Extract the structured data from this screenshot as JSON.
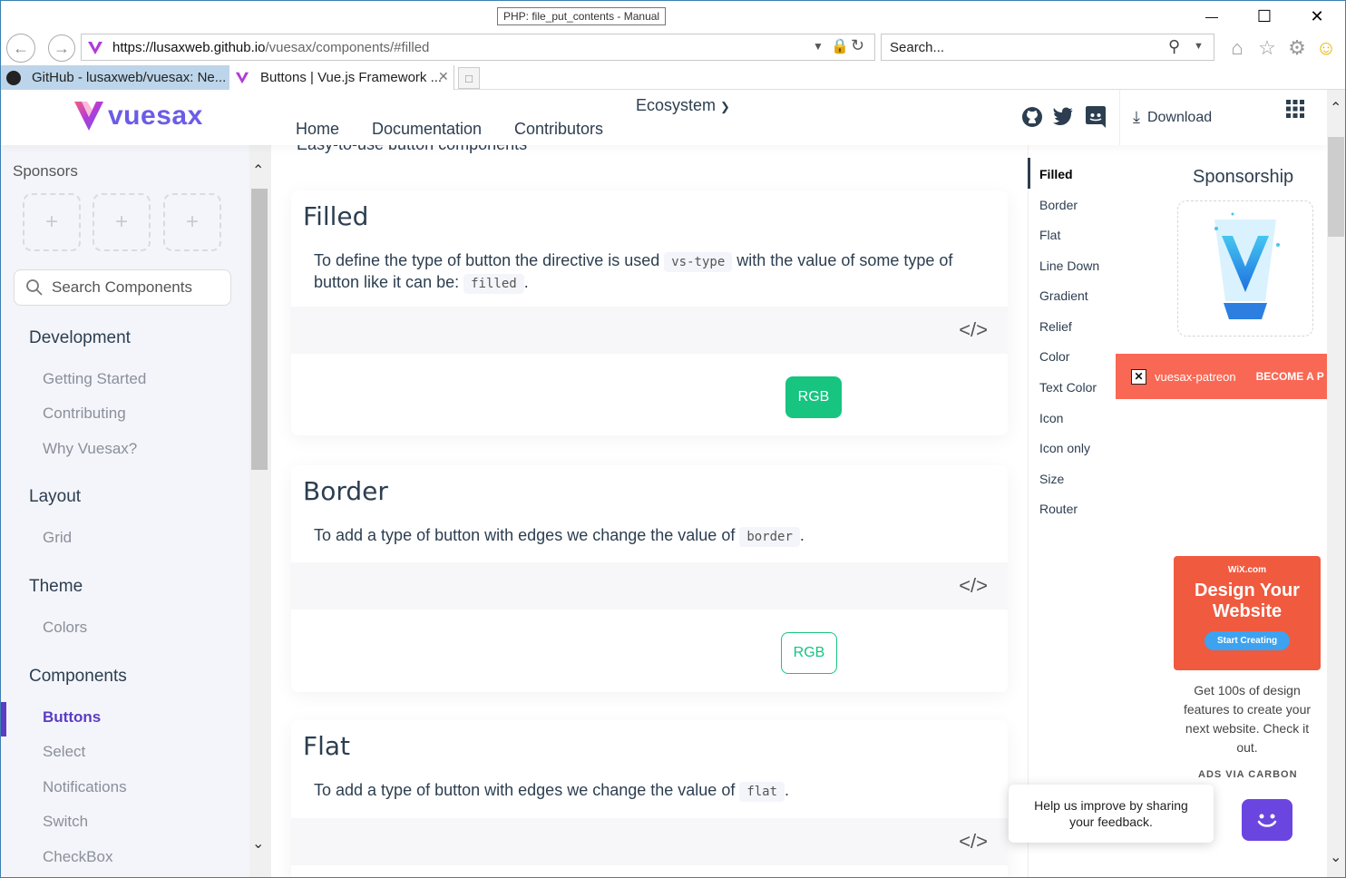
{
  "browser": {
    "tooltip": "PHP: file_put_contents - Manual",
    "address": "https://lusaxweb.github.io/vuesax/components/#filled",
    "address_host": "https://lusaxweb.github.io",
    "address_path": "/vuesax/components/#filled",
    "search_placeholder": "Search...",
    "tabs": [
      {
        "label": "GitHub - lusaxweb/vuesax: Ne...",
        "active": false
      },
      {
        "label": "Buttons | Vue.js Framework ...",
        "active": true
      }
    ],
    "minimize": "—",
    "maximize": "☐",
    "close": "✕"
  },
  "header": {
    "logo_text": "vuesax",
    "nav": [
      "Home",
      "Documentation",
      "Contributors"
    ],
    "ecosystem": "Ecosystem",
    "download": "Download"
  },
  "sidebar": {
    "sponsors_title": "Sponsors",
    "sponsor_slots": [
      "+",
      "+",
      "+"
    ],
    "search_placeholder": "Search Components",
    "groups": [
      {
        "title": "Development",
        "items": [
          "Getting Started",
          "Contributing",
          "Why Vuesax?"
        ]
      },
      {
        "title": "Layout",
        "items": [
          "Grid"
        ]
      },
      {
        "title": "Theme",
        "items": [
          "Colors"
        ]
      },
      {
        "title": "Components",
        "items": [
          "Buttons",
          "Select",
          "Notifications",
          "Switch",
          "CheckBox"
        ]
      }
    ],
    "active_item": "Buttons"
  },
  "main": {
    "intro": "Easy-to-use button components",
    "cards": [
      {
        "title": "Filled",
        "desc_before": "To define the type of button the directive is used ",
        "code1": "vs-type",
        "desc_middle": " with the value of some type of button like it can be: ",
        "code2": "filled",
        "desc_after": ".",
        "button": "RGB"
      },
      {
        "title": "Border",
        "desc_before": "To add a type of button with edges we change the value of ",
        "code1": "border",
        "desc_after": ".",
        "button": "RGB"
      },
      {
        "title": "Flat",
        "desc_before": "To add a type of button with edges we change the value of ",
        "code1": "flat",
        "desc_after": "."
      }
    ],
    "code_toggle": "</>"
  },
  "toc": {
    "items": [
      "Filled",
      "Border",
      "Flat",
      "Line Down",
      "Gradient",
      "Relief",
      "Color",
      "Text Color",
      "Icon",
      "Icon only",
      "Size",
      "Router"
    ],
    "active": "Filled"
  },
  "right": {
    "sponsorship_title": "Sponsorship",
    "patreon_label": "vuesax-patreon",
    "patreon_cta": "BECOME A P",
    "wix_brand": "WiX.com",
    "wix_title_1": "Design Your",
    "wix_title_2": "Website",
    "wix_cta": "Start Creating",
    "carbon_text": "Get 100s of design features to create your next website. Check it out.",
    "ads_via": "ADS VIA CARBON"
  },
  "feedback": {
    "text": "Help us improve by sharing your feedback."
  },
  "colors": {
    "primary": "#5b3cc4",
    "success": "#17c480",
    "patreon": "#f96854",
    "wix": "#f05a3f"
  }
}
